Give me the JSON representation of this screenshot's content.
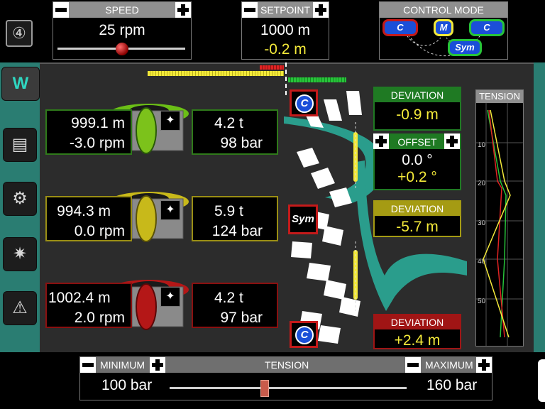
{
  "top": {
    "gear_icon": "gear-position-icon",
    "speed": {
      "label": "SPEED",
      "value": "25 rpm",
      "slider_level": 0.55
    },
    "setpoint": {
      "label": "SETPOINT",
      "value": "1000 m",
      "offset": "-0.2 m"
    },
    "control_mode": {
      "label": "CONTROL MODE",
      "left": "C",
      "middle": "M",
      "right": "C",
      "bottom": "Sym"
    }
  },
  "winches": [
    {
      "color": "#7cc21b",
      "length": "999.1 m",
      "rpm": "-3.0 rpm",
      "tension": "4.2 t",
      "pressure": "98 bar"
    },
    {
      "color": "#c8b91a",
      "length": "994.3 m",
      "rpm": "0.0 rpm",
      "tension": "5.9 t",
      "pressure": "124 bar"
    },
    {
      "color": "#b41717",
      "length": "1002.4 m",
      "rpm": "2.0 rpm",
      "tension": "4.2 t",
      "pressure": "97 bar"
    }
  ],
  "badges": {
    "top": "C",
    "middle": "Sym",
    "bottom": "C"
  },
  "deviations": [
    {
      "label": "DEVIATION",
      "value": "-0.9 m",
      "color": "#1f7a23"
    },
    {
      "label": "OFFSET",
      "value": "0.0 °",
      "value2": "+0.2 °",
      "color": "#1f7a23"
    },
    {
      "label": "DEVIATION",
      "value": "-5.7 m",
      "color": "#a59b13"
    },
    {
      "label": "DEVIATION",
      "value": "+2.4 m",
      "color": "#a01515"
    }
  ],
  "tension_chart": {
    "label": "TENSION",
    "ticks": [
      "10'",
      "20'",
      "30'",
      "40'",
      "50'"
    ]
  },
  "bottom": {
    "minimum_label": "MINIMUM",
    "minimum_value": "100 bar",
    "tension_label": "TENSION",
    "maximum_label": "MAXIMUM",
    "maximum_value": "160 bar",
    "slider_level": 0.4
  },
  "sidebar": [
    "winch-overview-icon",
    "motor-icon",
    "gearbox-icon",
    "gear-icon",
    "alarm-icon"
  ],
  "colors": {
    "teal": "#2a7d72",
    "yellow": "#f4ea3a",
    "red": "#c41a1a",
    "green": "#27c43a"
  }
}
